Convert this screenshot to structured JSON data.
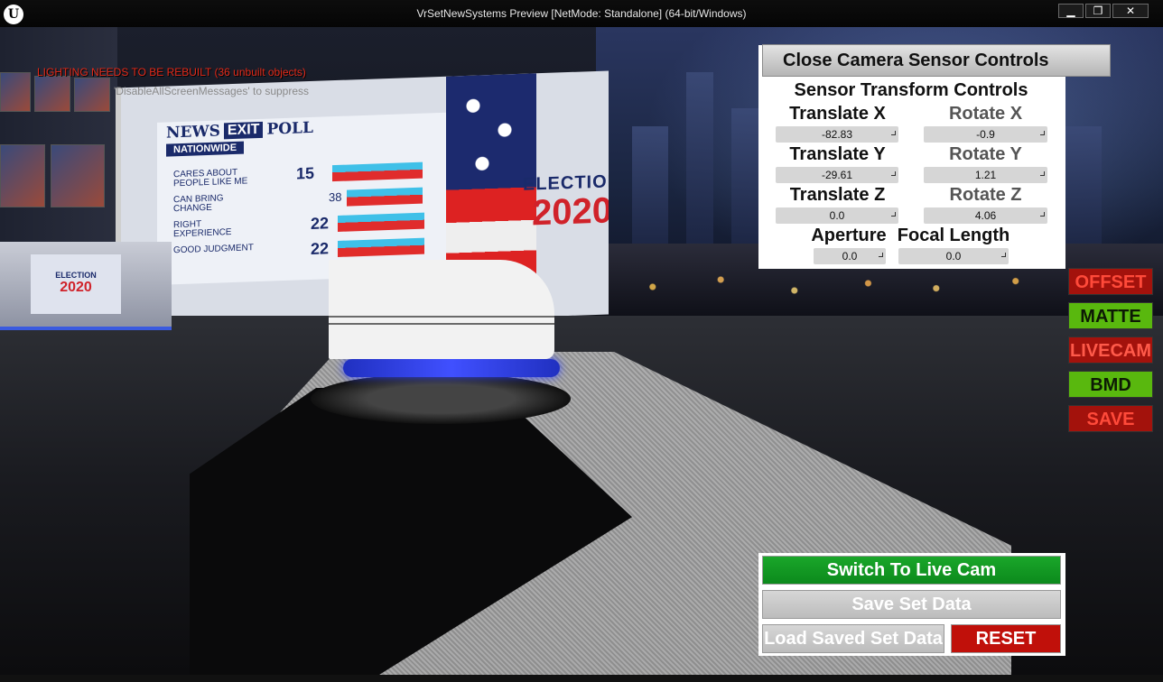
{
  "window": {
    "title": "VrSetNewSystems Preview [NetMode: Standalone]  (64-bit/Windows)",
    "logo": "U",
    "minimize": "▁",
    "maximize": "❐",
    "close": "✕"
  },
  "messages": {
    "warning": "LIGHTING NEEDS TO BE REBUILT (36 unbuilt objects)",
    "info": "'DisableAllScreenMessages' to suppress"
  },
  "scene": {
    "poll_brand": "NEWS",
    "poll_exit": "EXIT",
    "poll_word": "POLL",
    "poll_sub": "NATIONWIDE",
    "poll_rows": [
      {
        "label": "CARES ABOUT PEOPLE LIKE ME",
        "value": "15",
        "bar": 0.9
      },
      {
        "label": "CAN BRING CHANGE",
        "value": "38",
        "bar": 0.65
      },
      {
        "label": "RIGHT EXPERIENCE",
        "value": "22",
        "bar": 0.6
      },
      {
        "label": "GOOD JUDGMENT",
        "value": "22",
        "bar": 0.6
      }
    ],
    "election_word": "ELECTION",
    "election_year": "2020",
    "desk_screen_word": "ELECTION",
    "desk_screen_year": "2020"
  },
  "sensor": {
    "close_label": "Close Camera Sensor Controls",
    "title": "Sensor Transform Controls",
    "translate_x_label": "Translate X",
    "translate_x": "-82.83",
    "rotate_x_label": "Rotate X",
    "rotate_x": "-0.9",
    "translate_y_label": "Translate Y",
    "translate_y": "-29.61",
    "rotate_y_label": "Rotate Y",
    "rotate_y": "1.21",
    "translate_z_label": "Translate Z",
    "translate_z": "0.0",
    "rotate_z_label": "Rotate Z",
    "rotate_z": "4.06",
    "aperture_label": "Aperture",
    "aperture": "0.0",
    "focal_length_label": "Focal Length",
    "focal_length": "0.0"
  },
  "side_buttons": {
    "offset": "OFFSET",
    "matte": "MATTE",
    "livecam": "LIVECAM",
    "bmd": "BMD",
    "save": "SAVE"
  },
  "actions": {
    "switch_live": "Switch To Live Cam",
    "save_set": "Save Set Data",
    "load_set": "Load Saved Set Data",
    "reset": "RESET"
  },
  "colors": {
    "accent_green": "#1aa62a",
    "accent_red": "#c0100a",
    "warning_text": "#e32a1a"
  }
}
